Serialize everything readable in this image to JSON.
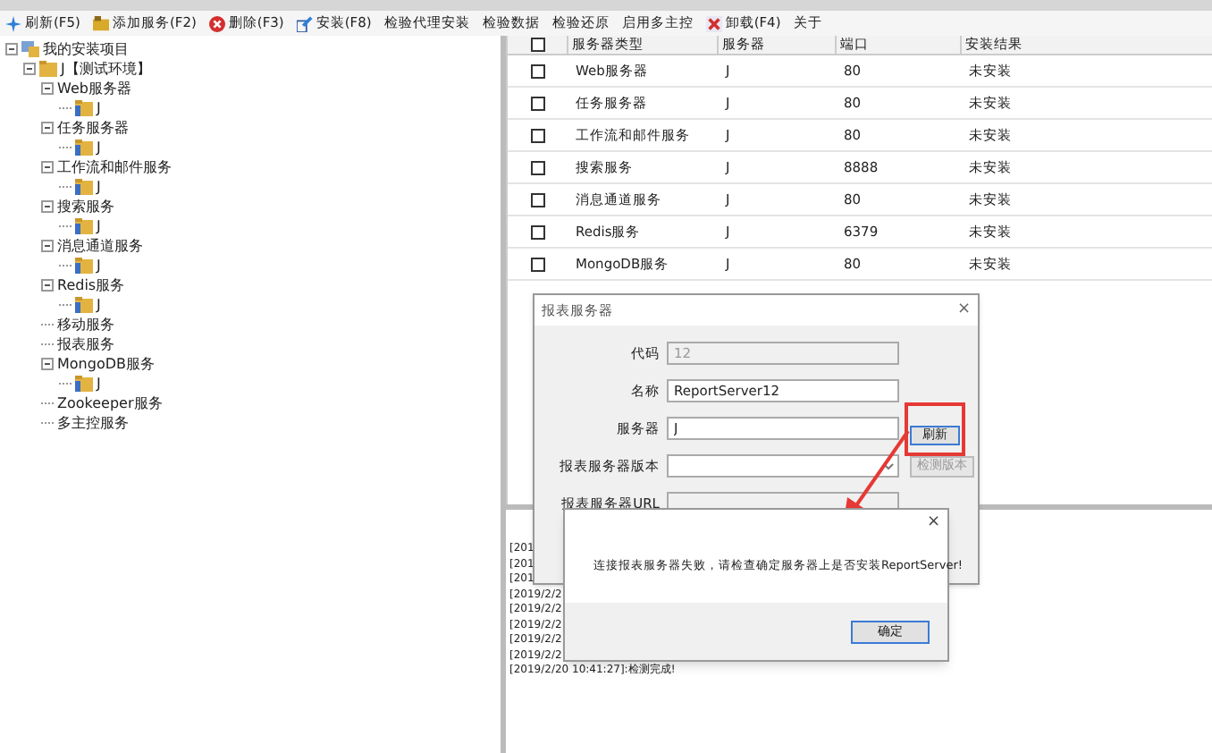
{
  "toolbar": [
    {
      "label": "刷新(F5)",
      "kind": "refresh"
    },
    {
      "label": "添加服务(F2)",
      "kind": "add"
    },
    {
      "label": "删除(F3)",
      "kind": "delete"
    },
    {
      "label": "安装(F8)",
      "kind": "install"
    },
    {
      "label": "检验代理安装",
      "kind": "plain"
    },
    {
      "label": "检验数据",
      "kind": "plain"
    },
    {
      "label": "检验还原",
      "kind": "plain"
    },
    {
      "label": "启用多主控",
      "kind": "plain"
    },
    {
      "label": "卸载(F4)",
      "kind": "uninstall"
    },
    {
      "label": "关于",
      "kind": "plain"
    }
  ],
  "tree": [
    {
      "label": "我的安装项目",
      "kind": "project",
      "expanded": true,
      "children": [
        {
          "label": "J【测试环境】",
          "kind": "env",
          "expanded": true,
          "children": [
            {
              "label": "Web服务器",
              "kind": "service",
              "expanded": true,
              "children": [
                {
                  "label": "J",
                  "kind": "server"
                }
              ]
            },
            {
              "label": "任务服务器",
              "kind": "service",
              "expanded": true,
              "children": [
                {
                  "label": "J",
                  "kind": "server"
                }
              ]
            },
            {
              "label": "工作流和邮件服务",
              "kind": "service",
              "expanded": true,
              "children": [
                {
                  "label": "J",
                  "kind": "server"
                }
              ]
            },
            {
              "label": "搜索服务",
              "kind": "service",
              "expanded": true,
              "children": [
                {
                  "label": "J",
                  "kind": "server"
                }
              ]
            },
            {
              "label": "消息通道服务",
              "kind": "service",
              "expanded": true,
              "children": [
                {
                  "label": "J",
                  "kind": "server"
                }
              ]
            },
            {
              "label": "Redis服务",
              "kind": "service",
              "expanded": true,
              "children": [
                {
                  "label": "J",
                  "kind": "server"
                }
              ]
            },
            {
              "label": "移动服务",
              "kind": "service"
            },
            {
              "label": "报表服务",
              "kind": "service"
            },
            {
              "label": "MongoDB服务",
              "kind": "service",
              "expanded": true,
              "children": [
                {
                  "label": "J",
                  "kind": "server"
                }
              ]
            },
            {
              "label": "Zookeeper服务",
              "kind": "service"
            },
            {
              "label": "多主控服务",
              "kind": "service"
            }
          ]
        }
      ]
    }
  ],
  "table": {
    "header_checked": false,
    "columns": [
      "服务器类型",
      "服务器",
      "端口",
      "安装结果"
    ],
    "rows": [
      {
        "checked": false,
        "cells": [
          "Web服务器",
          "J",
          "80",
          "未安装"
        ]
      },
      {
        "checked": false,
        "cells": [
          "任务服务器",
          "J",
          "80",
          "未安装"
        ]
      },
      {
        "checked": false,
        "cells": [
          "工作流和邮件服务",
          "J",
          "80",
          "未安装"
        ]
      },
      {
        "checked": false,
        "cells": [
          "搜索服务",
          "J",
          "8888",
          "未安装"
        ]
      },
      {
        "checked": false,
        "cells": [
          "消息通道服务",
          "J",
          "80",
          "未安装"
        ]
      },
      {
        "checked": false,
        "cells": [
          "Redis服务",
          "J",
          "6379",
          "未安装"
        ]
      },
      {
        "checked": false,
        "cells": [
          "MongoDB服务",
          "J",
          "80",
          "未安装"
        ]
      }
    ]
  },
  "log": [
    "[201",
    "[201",
    "[201",
    "[2019/2/2",
    "[2019/2/2",
    "[2019/2/2",
    "[2019/2/2",
    "[2019/2/2",
    "[2019/2/20 10:41:27]:检测完成!"
  ],
  "dialog": {
    "title": "报表服务器",
    "close": "×",
    "fields": [
      {
        "label": "代码",
        "value": "12",
        "kind": "text",
        "disabled": true
      },
      {
        "label": "名称",
        "value": "ReportServer12",
        "kind": "text",
        "disabled": false
      },
      {
        "label": "服务器",
        "value": "J",
        "kind": "server",
        "disabled": false,
        "button": "刷新"
      },
      {
        "label": "报表服务器版本",
        "kind": "select",
        "disabled": false,
        "button": "检测版本"
      },
      {
        "label": "报表服务器URL",
        "kind": "text",
        "disabled": true
      }
    ]
  },
  "message": {
    "close": "×",
    "text": "连接报表服务器失败，请检查确定服务器上是否安装ReportServer!",
    "button": "确定"
  }
}
